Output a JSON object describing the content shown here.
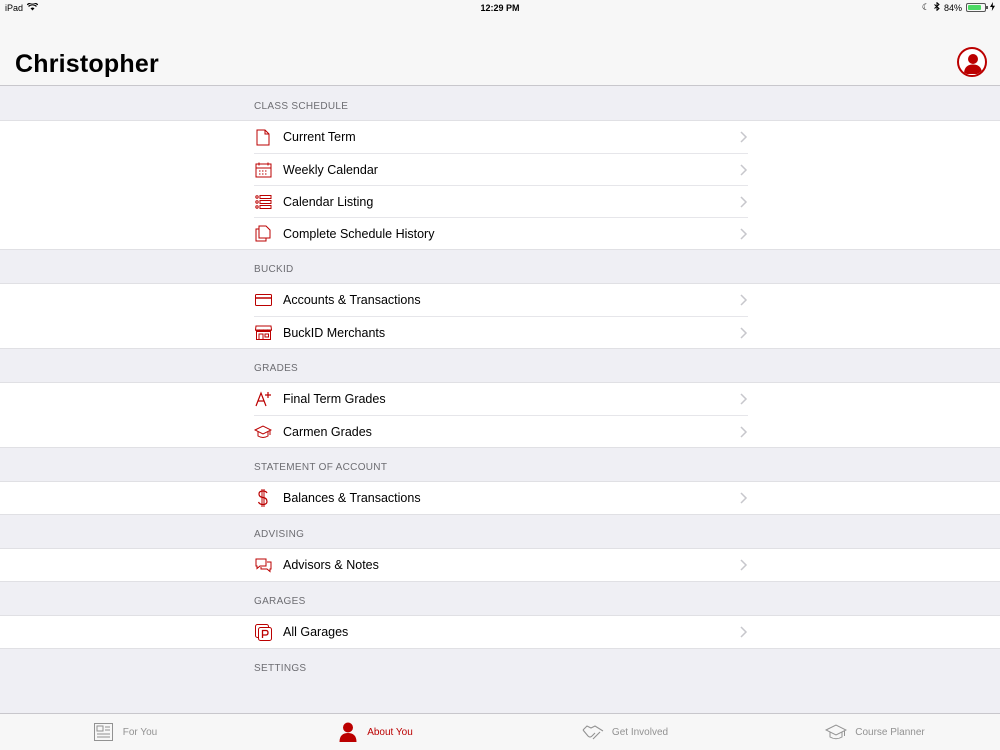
{
  "status_bar": {
    "device": "iPad",
    "time": "12:29 PM",
    "battery": "84%",
    "battery_level": 0.84
  },
  "header": {
    "title": "Christopher"
  },
  "colors": {
    "accent": "#bb0000",
    "muted": "#929292"
  },
  "sections": [
    {
      "title": "CLASS SCHEDULE",
      "items": [
        {
          "label": "Current Term",
          "icon": "document-icon"
        },
        {
          "label": "Weekly Calendar",
          "icon": "calendar-icon"
        },
        {
          "label": "Calendar Listing",
          "icon": "list-icon"
        },
        {
          "label": "Complete Schedule History",
          "icon": "documents-stack-icon"
        }
      ]
    },
    {
      "title": "BUCKID",
      "items": [
        {
          "label": "Accounts & Transactions",
          "icon": "card-icon"
        },
        {
          "label": "BuckID Merchants",
          "icon": "store-icon"
        }
      ]
    },
    {
      "title": "GRADES",
      "items": [
        {
          "label": "Final Term Grades",
          "icon": "grade-a-plus-icon"
        },
        {
          "label": "Carmen Grades",
          "icon": "graduation-cap-icon"
        }
      ]
    },
    {
      "title": "STATEMENT OF ACCOUNT",
      "items": [
        {
          "label": "Balances & Transactions",
          "icon": "dollar-icon"
        }
      ]
    },
    {
      "title": "ADVISING",
      "items": [
        {
          "label": "Advisors & Notes",
          "icon": "chat-bubbles-icon"
        }
      ]
    },
    {
      "title": "GARAGES",
      "items": [
        {
          "label": "All Garages",
          "icon": "parking-icon"
        }
      ]
    },
    {
      "title": "SETTINGS",
      "items": []
    }
  ],
  "tabs": [
    {
      "label": "For You",
      "icon": "newspaper-icon",
      "active": false
    },
    {
      "label": "About You",
      "icon": "person-icon",
      "active": true
    },
    {
      "label": "Get Involved",
      "icon": "handshake-icon",
      "active": false
    },
    {
      "label": "Course Planner",
      "icon": "graduation-cap-icon",
      "active": false
    }
  ]
}
